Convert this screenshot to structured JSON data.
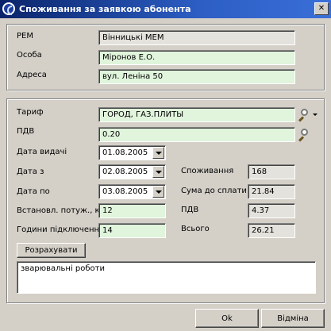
{
  "window": {
    "title": "Споживання за заявкою абонента",
    "close_glyph": "✕"
  },
  "top": {
    "rem_label": "РЕМ",
    "rem_value": "Вінницькі МЕМ",
    "person_label": "Особа",
    "person_value": "Міронов Е.О.",
    "address_label": "Адреса",
    "address_value": "вул. Леніна 50"
  },
  "form": {
    "tariff_label": "Тариф",
    "tariff_value": "ГОРОД, ГАЗ.ПЛИТЫ",
    "vat_label": "ПДВ",
    "vat_value": "0.20",
    "issue_date_label": "Дата видачі",
    "issue_date_value": "01.08.2005",
    "date_from_label": "Дата з",
    "date_from_value": "02.08.2005",
    "date_to_label": "Дата по",
    "date_to_value": "03.08.2005",
    "power_label": "Встановл. потуж., кВт",
    "power_value": "12",
    "hours_label": "Години підключення",
    "hours_value": "14",
    "consumption_label": "Споживання",
    "consumption_value": "168",
    "sum_label": "Сума до сплати",
    "sum_value": "21.84",
    "vat_sum_label": "ПДВ",
    "vat_sum_value": "4.37",
    "total_label": "Всього",
    "total_value": "26.21",
    "calculate_label": "Розрахувати",
    "note_text": "зварювальні роботи"
  },
  "buttons": {
    "ok_label": "Ok",
    "cancel_label": "Відміна"
  },
  "icons": {
    "app": "app-c-icon",
    "search": "magnifier-icon",
    "dropdown": "chevron-down-icon"
  },
  "colors": {
    "title_bar": "#0a246a",
    "window_bg": "#d4d0c8",
    "edit_field_bg": "#e0f5dc",
    "readonly_bg": "#e4e2dc"
  }
}
